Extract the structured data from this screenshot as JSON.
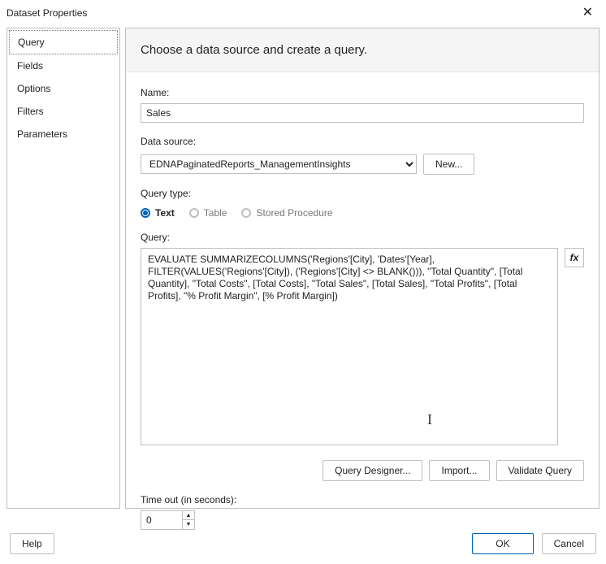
{
  "window": {
    "title": "Dataset Properties",
    "close_glyph": "✕"
  },
  "sidebar": {
    "items": [
      {
        "label": "Query",
        "selected": true
      },
      {
        "label": "Fields"
      },
      {
        "label": "Options"
      },
      {
        "label": "Filters"
      },
      {
        "label": "Parameters"
      }
    ]
  },
  "main": {
    "heading": "Choose a data source and create a query.",
    "name_label": "Name:",
    "name_value": "Sales",
    "datasource_label": "Data source:",
    "datasource_value": "EDNAPaginatedReports_ManagementInsights",
    "new_button": "New...",
    "querytype_label": "Query type:",
    "querytype_options": {
      "text": "Text",
      "table": "Table",
      "stored": "Stored Procedure"
    },
    "query_label": "Query:",
    "query_text": "EVALUATE SUMMARIZECOLUMNS('Regions'[City], 'Dates'[Year], FILTER(VALUES('Regions'[City]), ('Regions'[City] <> BLANK())), \"Total Quantity\", [Total Quantity], \"Total Costs\", [Total Costs], \"Total Sales\", [Total Sales], \"Total Profits\", [Total Profits], \"% Profit Margin\", [% Profit Margin])",
    "fx_label": "fx",
    "query_designer": "Query Designer...",
    "import": "Import...",
    "validate": "Validate Query",
    "timeout_label": "Time out (in seconds):",
    "timeout_value": "0"
  },
  "footer": {
    "help": "Help",
    "ok": "OK",
    "cancel": "Cancel"
  }
}
